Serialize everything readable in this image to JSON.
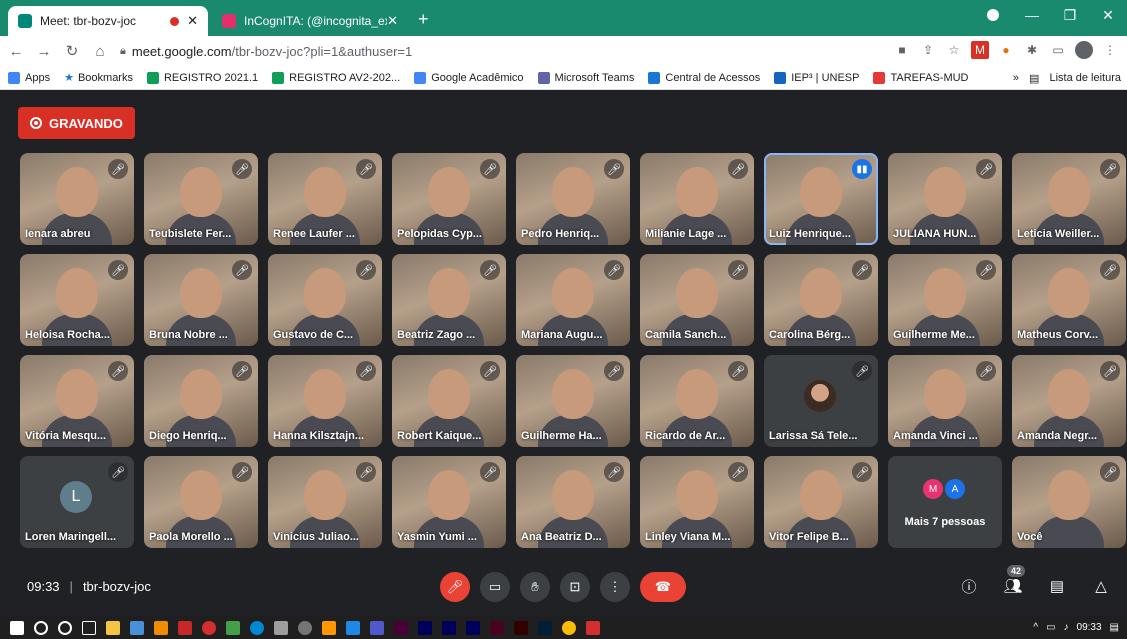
{
  "browser": {
    "tabs": [
      {
        "title": "Meet: tbr-bozv-joc",
        "recording": true,
        "favicon_color": "#00897b"
      },
      {
        "title": "InCognITA: (@incognita_expo) · I",
        "recording": false,
        "favicon_color": "#e1306c"
      }
    ],
    "url_host": "meet.google.com",
    "url_path": "/tbr-bozv-joc?pli=1&authuser=1",
    "bookmarks": [
      {
        "label": "Apps",
        "color": "#4285f4"
      },
      {
        "label": "Bookmarks",
        "color": "#1a73e8"
      },
      {
        "label": "REGISTRO 2021.1",
        "color": "#0f9d58"
      },
      {
        "label": "REGISTRO AV2-202...",
        "color": "#0f9d58"
      },
      {
        "label": "Google Acadêmico",
        "color": "#4285f4"
      },
      {
        "label": "Microsoft Teams",
        "color": "#6264a7"
      },
      {
        "label": "Central de Acessos",
        "color": "#1976d2"
      },
      {
        "label": "IEP³ | UNESP",
        "color": "#1565c0"
      },
      {
        "label": "TAREFAS-MUD",
        "color": "#e53935"
      }
    ],
    "bookmarks_more": "»",
    "reading_list": "Lista de leitura"
  },
  "meet": {
    "recording_label": "GRAVANDO",
    "participants": [
      {
        "name": "Ienara abreu",
        "type": "video"
      },
      {
        "name": "Teubislete Fer...",
        "type": "video"
      },
      {
        "name": "Renee Laufer ...",
        "type": "video"
      },
      {
        "name": "Pelopidas Cyp...",
        "type": "video"
      },
      {
        "name": "Pedro Henriq...",
        "type": "video"
      },
      {
        "name": "Milianie Lage ...",
        "type": "video"
      },
      {
        "name": "Luiz Henrique...",
        "type": "video",
        "speaking": true
      },
      {
        "name": "JULIANA HUN...",
        "type": "video"
      },
      {
        "name": "Leticia Weiller...",
        "type": "video"
      },
      {
        "name": "Heloisa Rocha...",
        "type": "video"
      },
      {
        "name": "Bruna Nobre ...",
        "type": "video"
      },
      {
        "name": "Gustavo de C...",
        "type": "video"
      },
      {
        "name": "Beatriz Zago ...",
        "type": "video"
      },
      {
        "name": "Mariana Augu...",
        "type": "video"
      },
      {
        "name": "Camila Sanch...",
        "type": "video"
      },
      {
        "name": "Carolina Bérg...",
        "type": "video"
      },
      {
        "name": "Guilherme Me...",
        "type": "video"
      },
      {
        "name": "Matheus Corv...",
        "type": "video"
      },
      {
        "name": "Vitória Mesqu...",
        "type": "video"
      },
      {
        "name": "Diego Henriq...",
        "type": "video"
      },
      {
        "name": "Hanna Kilsztajn...",
        "type": "video"
      },
      {
        "name": "Robert Kaique...",
        "type": "video"
      },
      {
        "name": "Guilherme Ha...",
        "type": "video"
      },
      {
        "name": "Ricardo de Ar...",
        "type": "video"
      },
      {
        "name": "Larissa Sá Tele...",
        "type": "photo"
      },
      {
        "name": "Amanda Vinci ...",
        "type": "video"
      },
      {
        "name": "Amanda Negr...",
        "type": "video"
      },
      {
        "name": "Loren Maringell...",
        "type": "avatar",
        "initial": "L"
      },
      {
        "name": "Paola Morello ...",
        "type": "video"
      },
      {
        "name": "Vinicius Juliao...",
        "type": "video"
      },
      {
        "name": "Yasmin Yumi ...",
        "type": "video"
      },
      {
        "name": "Ana Beatriz D...",
        "type": "video"
      },
      {
        "name": "Linley Viana M...",
        "type": "video"
      },
      {
        "name": "Vitor Felipe B...",
        "type": "video"
      },
      {
        "name": "Mais 7 pessoas",
        "type": "more",
        "initials": [
          "M",
          "A"
        ]
      },
      {
        "name": "Você",
        "type": "self"
      }
    ],
    "time": "09:33",
    "separator": "|",
    "meeting_code": "tbr-bozv-joc",
    "participant_count": "42"
  },
  "taskbar": {
    "clock": "09:33"
  },
  "colors": {
    "chrome_green": "#1a8a6f",
    "meet_bg": "#202124",
    "record_red": "#d93025",
    "end_call_red": "#ea4335",
    "speaking_blue": "#1a73e8"
  }
}
